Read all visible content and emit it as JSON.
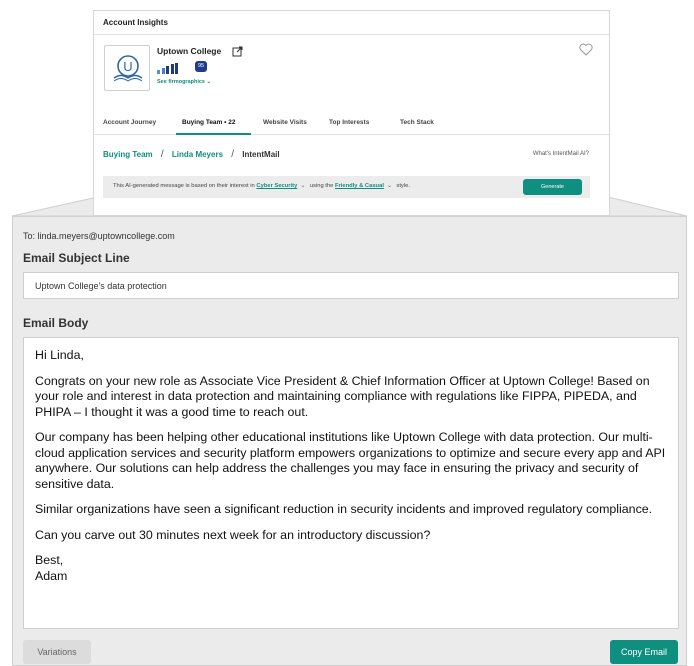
{
  "colors": {
    "accent": "#0f8f80",
    "badge": "#1f3d8a",
    "panel_bg": "#ebebeb"
  },
  "card": {
    "title": "Account Insights",
    "company": {
      "name": "Uptown College",
      "logo_letter": "U",
      "score": "95",
      "firmographics_link": "See firmographics ⌄",
      "intent_bars": 5
    },
    "tabs": [
      "Account Journey",
      "Buying Team • 22",
      "Website Visits",
      "Top Interests",
      "Tech Stack"
    ],
    "active_tab": 1,
    "breadcrumb": {
      "level1": "Buying Team",
      "sep1": "/",
      "level2": "Linda Meyers",
      "sep2": "/",
      "level3": "IntentMail"
    },
    "help_link": "What's IntentMail AI?",
    "banner": {
      "prefix": "This AI-generated message is based on their interest in",
      "interest": "Cyber Security",
      "middle": "using the",
      "tone": "Friendly & Casual",
      "suffix": "style.",
      "generate_label": "Generate"
    }
  },
  "email": {
    "to": "To: linda.meyers@uptowncollege.com",
    "subject_label": "Email Subject Line",
    "subject_value": "Uptown College's data protection",
    "body_label": "Email Body",
    "body": {
      "greeting": "Hi Linda,",
      "p1": "Congrats on your new role as Associate Vice President & Chief Information Officer at Uptown College! Based on your role and interest in data protection and maintaining compliance with regulations like FIPPA, PIPEDA, and PHIPA – I thought it was a good time to reach out.",
      "p2": "Our company has been helping other educational institutions like Uptown College with data protection. Our multi-cloud application services and security platform empowers organizations to optimize and secure every app and API anywhere. Our solutions can help address the challenges you may face in ensuring the privacy and security of sensitive data.",
      "p3": "Similar organizations have seen a significant reduction in security incidents and improved regulatory compliance.",
      "p4": "Can you carve out 30 minutes next week for an introductory discussion?",
      "closing": "Best,",
      "signature": "Adam"
    },
    "variations_label": "Variations",
    "copy_label": "Copy Email"
  },
  "icons": [
    "college-logo-icon",
    "external-link-icon",
    "heart-icon",
    "chevron-down-icon"
  ]
}
